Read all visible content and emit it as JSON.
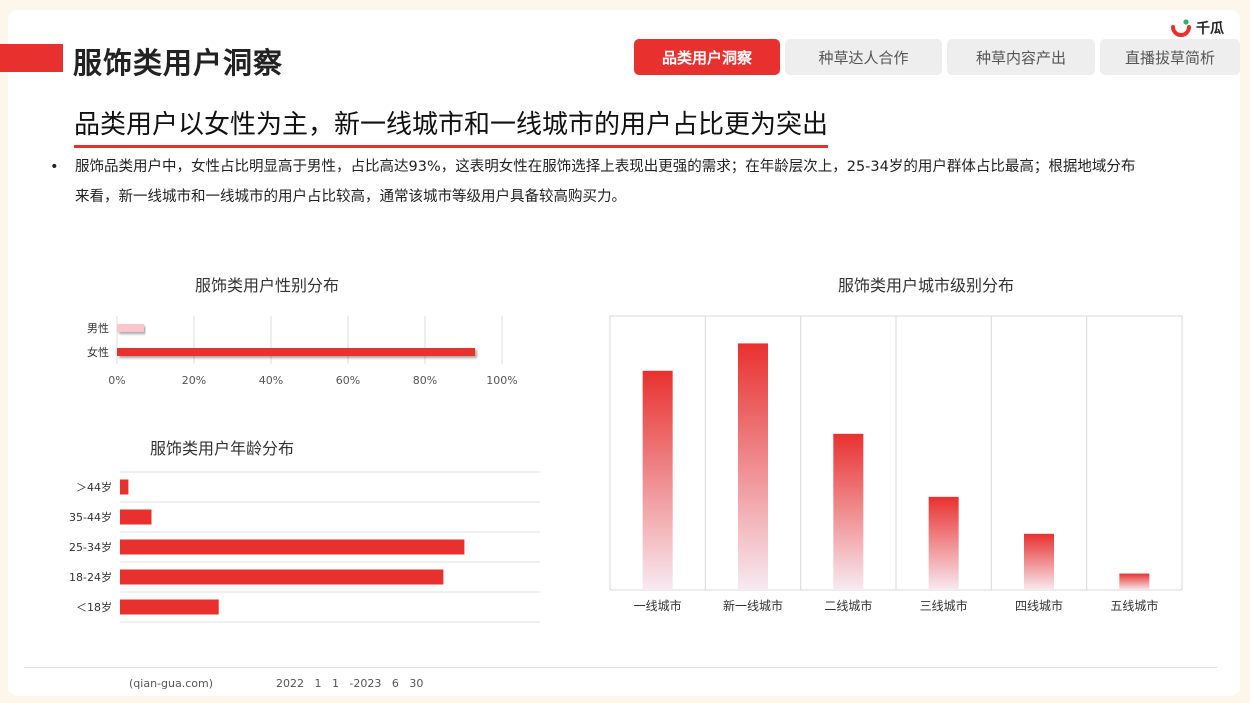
{
  "header": {
    "page_title": "服饰类用户洞察",
    "logo_text": "千瓜",
    "brand_color": "#e8312f"
  },
  "tabs": [
    {
      "label": "品类用户洞察",
      "active": true
    },
    {
      "label": "种草达人合作",
      "active": false
    },
    {
      "label": "种草内容产出",
      "active": false
    },
    {
      "label": "直播拔草简析",
      "active": false
    }
  ],
  "headline": "品类用户以女性为主，新一线城市和一线城市的用户占比更为突出",
  "bullet": {
    "marker": "•",
    "text": "服饰品类用户中，女性占比明显高于男性，占比高达93%，这表明女性在服饰选择上表现出更强的需求；在年龄层次上，25-34岁的用户群体占比最高；根据地域分布来看，新一线城市和一线城市的用户占比较高，通常该城市等级用户具备较高购买力。"
  },
  "chart_data": [
    {
      "type": "bar",
      "orientation": "horizontal",
      "title": "服饰类用户性别分布",
      "categories": [
        "男性",
        "女性"
      ],
      "values": [
        7,
        93
      ],
      "xlim": [
        0,
        100
      ],
      "xticks": [
        "0%",
        "20%",
        "40%",
        "60%",
        "80%",
        "100%"
      ],
      "colors": [
        "#f9c6cc",
        "#e8312f"
      ],
      "grid": true
    },
    {
      "type": "bar",
      "orientation": "horizontal",
      "title": "服饰类用户年龄分布",
      "categories": [
        "＞44岁",
        "35-44岁",
        "25-34岁",
        "18-24岁",
        "＜18岁"
      ],
      "values": [
        2,
        7.5,
        82,
        77,
        23.5
      ],
      "xlim": [
        0,
        100
      ],
      "color": "#e8312f",
      "grid": true
    },
    {
      "type": "bar",
      "orientation": "vertical",
      "title": "服饰类用户城市级别分布",
      "categories": [
        "一线城市",
        "新一线城市",
        "二线城市",
        "三线城市",
        "四线城市",
        "五线城市"
      ],
      "values": [
        80,
        90,
        57,
        34,
        20.5,
        6
      ],
      "ylim": [
        0,
        100
      ],
      "gradient": [
        "#e8312f",
        "#f7eaf1"
      ],
      "grid": true
    }
  ],
  "footer": {
    "source": "(qian-gua.com)",
    "date_range": "2022   1   1   -2023   6   30"
  }
}
